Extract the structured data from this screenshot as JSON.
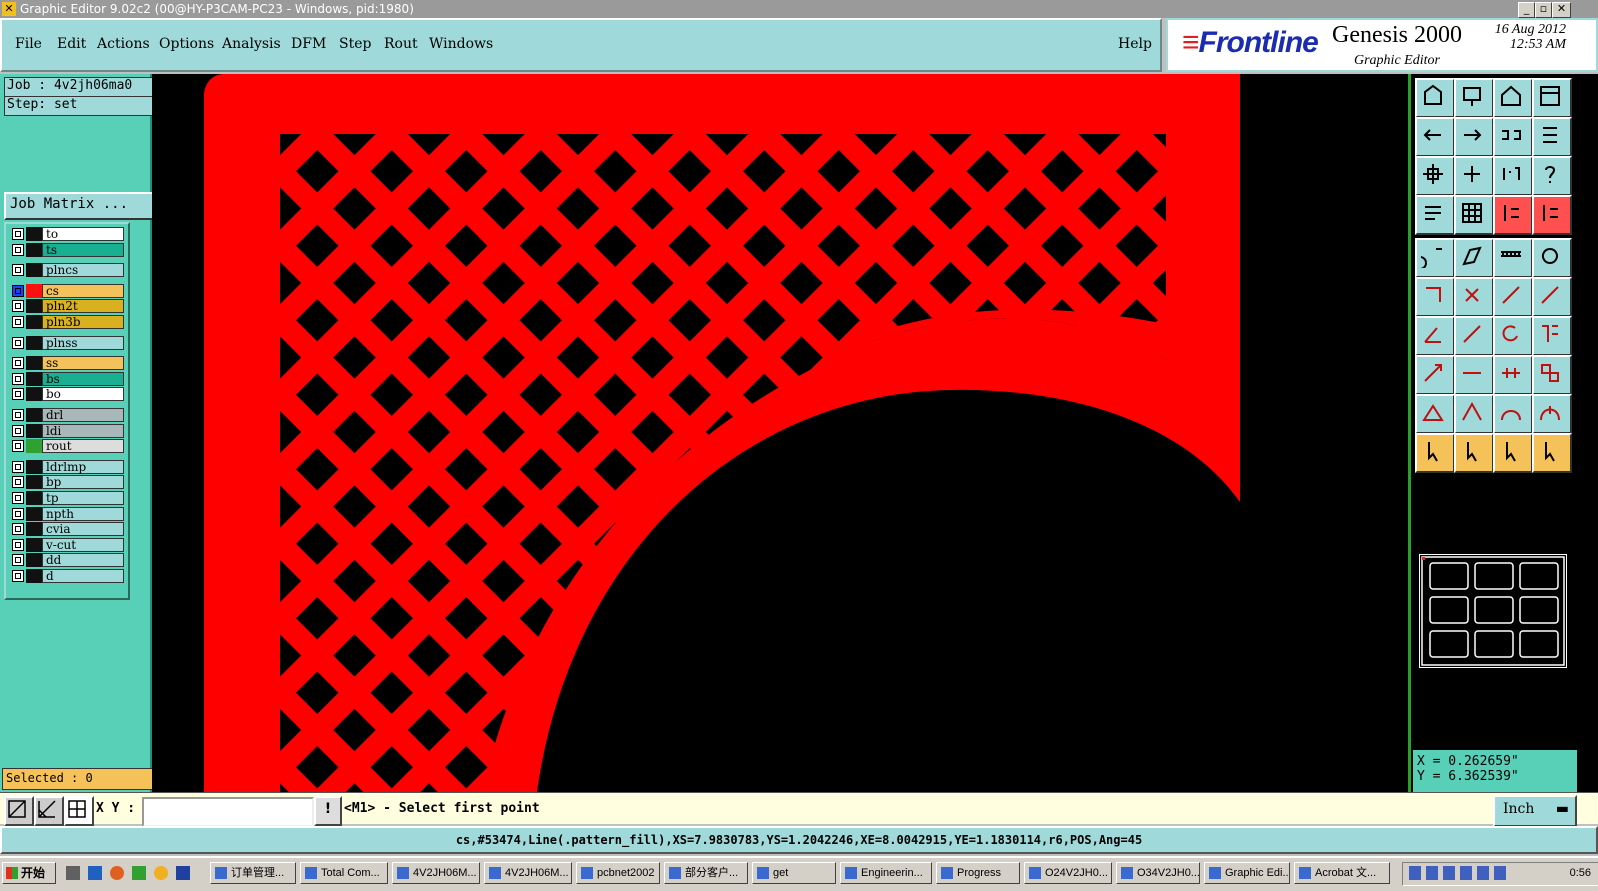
{
  "window": {
    "title": "Graphic Editor 9.02c2 (00@HY-P3CAM-PC23 - Windows, pid:1980)"
  },
  "menu": {
    "items": [
      "File",
      "Edit",
      "Actions",
      "Options",
      "Analysis",
      "DFM",
      "Step",
      "Rout",
      "Windows"
    ],
    "help": "Help"
  },
  "logo": {
    "brand": "Frontline",
    "product": "Genesis 2000",
    "subtitle": "Graphic Editor",
    "date": "16 Aug 2012",
    "time": "12:53 AM"
  },
  "job": {
    "job_label": "Job : 4v2jh06ma0",
    "step_label": "Step: set",
    "matrix_button": "Job Matrix ..."
  },
  "layers": [
    {
      "name": "to",
      "color": "#ffffff",
      "swatch": "#111111",
      "group": 0
    },
    {
      "name": "ts",
      "color": "#18b090",
      "swatch": "#111111",
      "group": 0
    },
    {
      "name": "plncs",
      "color": "#9fd9d9",
      "swatch": "#111111",
      "group": 1
    },
    {
      "name": "cs",
      "color": "#f5c25a",
      "swatch": "#ff1010",
      "group": 2,
      "active": true
    },
    {
      "name": "pln2t",
      "color": "#d8b020",
      "swatch": "#111111",
      "group": 2
    },
    {
      "name": "pln3b",
      "color": "#d8b020",
      "swatch": "#111111",
      "group": 2
    },
    {
      "name": "plnss",
      "color": "#9fd9d9",
      "swatch": "#111111",
      "group": 3
    },
    {
      "name": "ss",
      "color": "#f5c25a",
      "swatch": "#111111",
      "group": 4
    },
    {
      "name": "bs",
      "color": "#18b090",
      "swatch": "#111111",
      "group": 4
    },
    {
      "name": "bo",
      "color": "#ffffff",
      "swatch": "#111111",
      "group": 4
    },
    {
      "name": "drl",
      "color": "#a8b8b8",
      "swatch": "#111111",
      "group": 5
    },
    {
      "name": "ldi",
      "color": "#a8b8b8",
      "swatch": "#111111",
      "group": 5
    },
    {
      "name": "rout",
      "color": "#dddddd",
      "swatch": "#30a030",
      "group": 5
    },
    {
      "name": "ldrlmp",
      "color": "#9fd9d9",
      "swatch": "#111111",
      "group": 6
    },
    {
      "name": "bp",
      "color": "#9fd9d9",
      "swatch": "#111111",
      "group": 6
    },
    {
      "name": "tp",
      "color": "#9fd9d9",
      "swatch": "#111111",
      "group": 6
    },
    {
      "name": "npth",
      "color": "#9fd9d9",
      "swatch": "#111111",
      "group": 6
    },
    {
      "name": "cvia",
      "color": "#9fd9d9",
      "swatch": "#111111",
      "group": 6
    },
    {
      "name": "v-cut",
      "color": "#9fd9d9",
      "swatch": "#111111",
      "group": 6
    },
    {
      "name": "dd",
      "color": "#9fd9d9",
      "swatch": "#111111",
      "group": 6
    },
    {
      "name": "d",
      "color": "#9fd9d9",
      "swatch": "#111111",
      "group": 6
    }
  ],
  "selected": {
    "label": "Selected : 0"
  },
  "coords": {
    "x": "X = 0.262659\"",
    "y": "Y = 6.362539\""
  },
  "input": {
    "xy_label": "X Y :",
    "xy_value": "",
    "bang": "!",
    "prompt": "<M1> - Select first point",
    "units": "Inch"
  },
  "status": {
    "text": "cs,#53474,Line(.pattern_fill),XS=7.9830783,YS=1.2042246,XE=8.0042915,YE=1.1830114,r6,POS,Ang=45"
  },
  "taskbar": {
    "start": "开始",
    "tasks": [
      "订单管理...",
      "Total Com...",
      "4V2JH06M...",
      "4V2JH06M...",
      "pcbnet2002",
      "部分客户...",
      "get",
      "Engineerin...",
      "Progress",
      "O24V2JH0...",
      "O34V2JH0...",
      "Graphic Edi...",
      "Acrobat 文..."
    ],
    "clock": "0:56"
  },
  "colors": {
    "copper": "#ff0000",
    "background": "#000000",
    "accent": "#9fd9d9",
    "panel": "#58d0b8"
  }
}
